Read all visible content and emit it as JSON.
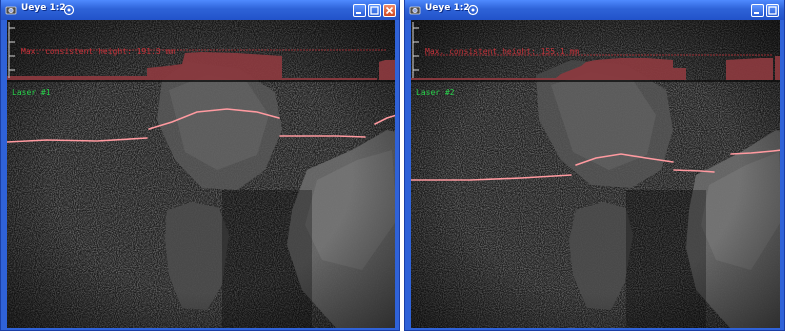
{
  "windows": [
    {
      "title": "Ueye 1:2",
      "buttons": [
        "minimize",
        "maximize",
        "close"
      ],
      "overlay": {
        "height_text": "Max. consistent height: 191.3 mm",
        "laser_label": "Laser #1"
      }
    },
    {
      "title": "Ueye 1:2",
      "buttons": [
        "minimize",
        "maximize"
      ],
      "overlay": {
        "height_text": "Max. consistent height: 155.1 mm",
        "laser_label": "Laser #2"
      }
    }
  ],
  "icons": {
    "app": "camera-app-icon",
    "pin": "pin-icon",
    "minimize": "minimize-icon",
    "maximize": "maximize-icon",
    "close": "close-icon"
  },
  "colors": {
    "titlebar": "#2e63d8",
    "height_text": "#c4323a",
    "laser_label": "#27d34a",
    "histogram_fill": "#8c3a3f",
    "laser_line": "#ff9aa0"
  }
}
